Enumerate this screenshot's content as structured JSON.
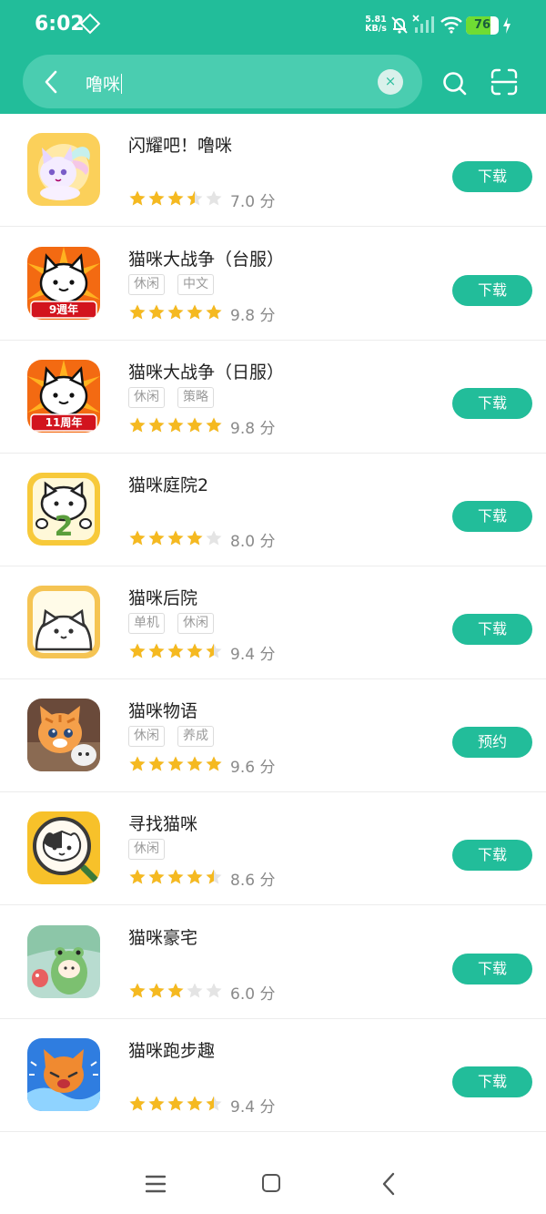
{
  "status_bar": {
    "time": "6:02",
    "net_speed_value": "5.81",
    "net_speed_unit": "KB/s",
    "battery": "76",
    "battery_level": 0.76
  },
  "search": {
    "query": "噜咪",
    "clear_icon": "×"
  },
  "colors": {
    "brand": "#22bd9a",
    "star": "#f5b920",
    "star_empty": "#e4e4e4"
  },
  "apps": [
    {
      "name": "闪耀吧！噜咪",
      "tags": [],
      "rating": 3.5,
      "score": "7.0 分",
      "action": "下载",
      "icon": "winged-cat-icon"
    },
    {
      "name": "猫咪大战争（台服）",
      "tags": [
        "休闲",
        "中文"
      ],
      "rating": 5,
      "score": "9.8 分",
      "action": "下载",
      "icon": "battle-cats-9th-icon",
      "badge": "9週年"
    },
    {
      "name": "猫咪大战争（日服）",
      "tags": [
        "休闲",
        "策略"
      ],
      "rating": 5,
      "score": "9.8 分",
      "action": "下载",
      "icon": "battle-cats-11th-icon",
      "badge": "11周年"
    },
    {
      "name": "猫咪庭院2",
      "tags": [],
      "rating": 4,
      "score": "8.0 分",
      "action": "下载",
      "icon": "cat-number-2-icon",
      "badge": "2"
    },
    {
      "name": "猫咪后院",
      "tags": [
        "单机",
        "休闲"
      ],
      "rating": 4.5,
      "score": "9.4 分",
      "action": "下载",
      "icon": "white-cat-icon"
    },
    {
      "name": "猫咪物语",
      "tags": [
        "休闲",
        "养成"
      ],
      "rating": 5,
      "score": "9.6 分",
      "action": "预约",
      "icon": "orange-cat-icon"
    },
    {
      "name": "寻找猫咪",
      "tags": [
        "休闲"
      ],
      "rating": 4.5,
      "score": "8.6 分",
      "action": "下载",
      "icon": "magnifier-cat-icon"
    },
    {
      "name": "猫咪豪宅",
      "tags": [],
      "rating": 3,
      "score": "6.0 分",
      "action": "下载",
      "icon": "frog-hood-cat-icon"
    },
    {
      "name": "猫咪跑步趣",
      "tags": [],
      "rating": 4.5,
      "score": "9.4 分",
      "action": "下载",
      "icon": "running-cat-icon"
    }
  ],
  "nav": {
    "menu_icon": "menu-icon",
    "home_icon": "home-icon",
    "back_icon": "back-icon"
  }
}
